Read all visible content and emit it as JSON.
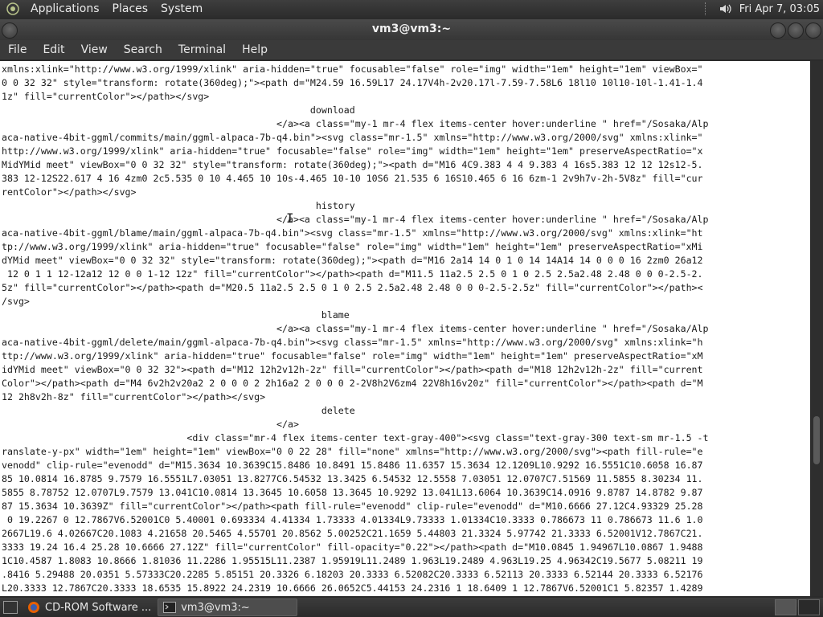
{
  "top_panel": {
    "menus": [
      "Applications",
      "Places",
      "System"
    ],
    "clock": "Fri Apr  7, 03:05"
  },
  "window": {
    "title": "vm3@vm3:~"
  },
  "menubar": {
    "items": [
      "File",
      "Edit",
      "View",
      "Search",
      "Terminal",
      "Help"
    ]
  },
  "terminal": {
    "content": "xmlns:xlink=\"http://www.w3.org/1999/xlink\" aria-hidden=\"true\" focusable=\"false\" role=\"img\" width=\"1em\" height=\"1em\" viewBox=\"\n0 0 32 32\" style=\"transform: rotate(360deg);\"><path d=\"M24.59 16.59L17 24.17V4h-2v20.17l-7.59-7.58L6 18l10 10l10-10l-1.41-1.4\n1z\" fill=\"currentColor\"></path></svg>\n                                                       download\n                                                 </a><a class=\"my-1 mr-4 flex items-center hover:underline \" href=\"/Sosaka/Alp\naca-native-4bit-ggml/commits/main/ggml-alpaca-7b-q4.bin\"><svg class=\"mr-1.5\" xmlns=\"http://www.w3.org/2000/svg\" xmlns:xlink=\"\nhttp://www.w3.org/1999/xlink\" aria-hidden=\"true\" focusable=\"false\" role=\"img\" width=\"1em\" height=\"1em\" preserveAspectRatio=\"x\nMidYMid meet\" viewBox=\"0 0 32 32\" style=\"transform: rotate(360deg);\"><path d=\"M16 4C9.383 4 4 9.383 4 16s5.383 12 12 12s12-5.\n383 12-12S22.617 4 16 4zm0 2c5.535 0 10 4.465 10 10s-4.465 10-10 10S6 21.535 6 16S10.465 6 16 6zm-1 2v9h7v-2h-5V8z\" fill=\"cur\nrentColor\"></path></svg>\n                                                        history\n                                                 </a><a class=\"my-1 mr-4 flex items-center hover:underline \" href=\"/Sosaka/Alp\naca-native-4bit-ggml/blame/main/ggml-alpaca-7b-q4.bin\"><svg class=\"mr-1.5\" xmlns=\"http://www.w3.org/2000/svg\" xmlns:xlink=\"ht\ntp://www.w3.org/1999/xlink\" aria-hidden=\"true\" focusable=\"false\" role=\"img\" width=\"1em\" height=\"1em\" preserveAspectRatio=\"xMi\ndYMid meet\" viewBox=\"0 0 32 32\" style=\"transform: rotate(360deg);\"><path d=\"M16 2a14 14 0 1 0 14 14A14 14 0 0 0 16 2zm0 26a12\n 12 0 1 1 12-12a12 12 0 0 1-12 12z\" fill=\"currentColor\"></path><path d=\"M11.5 11a2.5 2.5 0 1 0 2.5 2.5a2.48 2.48 0 0 0-2.5-2.\n5z\" fill=\"currentColor\"></path><path d=\"M20.5 11a2.5 2.5 0 1 0 2.5 2.5a2.48 2.48 0 0 0-2.5-2.5z\" fill=\"currentColor\"></path><\n/svg>\n                                                         blame\n                                                 </a><a class=\"my-1 mr-4 flex items-center hover:underline \" href=\"/Sosaka/Alp\naca-native-4bit-ggml/delete/main/ggml-alpaca-7b-q4.bin\"><svg class=\"mr-1.5\" xmlns=\"http://www.w3.org/2000/svg\" xmlns:xlink=\"h\nttp://www.w3.org/1999/xlink\" aria-hidden=\"true\" focusable=\"false\" role=\"img\" width=\"1em\" height=\"1em\" preserveAspectRatio=\"xM\nidYMid meet\" viewBox=\"0 0 32 32\"><path d=\"M12 12h2v12h-2z\" fill=\"currentColor\"></path><path d=\"M18 12h2v12h-2z\" fill=\"current\nColor\"></path><path d=\"M4 6v2h2v20a2 2 0 0 0 2 2h16a2 2 0 0 0 2-2V8h2V6zm4 22V8h16v20z\" fill=\"currentColor\"></path><path d=\"M\n12 2h8v2h-8z\" fill=\"currentColor\"></path></svg>\n                                                         delete\n                                                 </a>\n                                 <div class=\"mr-4 flex items-center text-gray-400\"><svg class=\"text-gray-300 text-sm mr-1.5 -t\nranslate-y-px\" width=\"1em\" height=\"1em\" viewBox=\"0 0 22 28\" fill=\"none\" xmlns=\"http://www.w3.org/2000/svg\"><path fill-rule=\"e\nvenodd\" clip-rule=\"evenodd\" d=\"M15.3634 10.3639C15.8486 10.8491 15.8486 11.6357 15.3634 12.1209L10.9292 16.5551C10.6058 16.87\n85 10.0814 16.8785 9.7579 16.5551L7.03051 13.8277C6.54532 13.3425 6.54532 12.5558 7.03051 12.0707C7.51569 11.5855 8.30234 11.\n5855 8.78752 12.0707L9.7579 13.041C10.0814 13.3645 10.6058 13.3645 10.9292 13.041L13.6064 10.3639C14.0916 9.8787 14.8782 9.87\n87 15.3634 10.3639Z\" fill=\"currentColor\"></path><path fill-rule=\"evenodd\" clip-rule=\"evenodd\" d=\"M10.6666 27.12C4.93329 25.28\n 0 19.2267 0 12.7867V6.52001C0 5.40001 0.693334 4.41334 1.73333 4.01334L9.73333 1.01334C10.3333 0.786673 11 0.786673 11.6 1.0\n2667L19.6 4.02667C20.1083 4.21658 20.5465 4.55701 20.8562 5.00252C21.1659 5.44803 21.3324 5.97742 21.3333 6.52001V12.7867C21.\n3333 19.24 16.4 25.28 10.6666 27.12Z\" fill=\"currentColor\" fill-opacity=\"0.22\"></path><path d=\"M10.0845 1.94967L10.0867 1.9488\n1C10.4587 1.8083 10.8666 1.81036 11.2286 1.95515L11.2387 1.95919L11.2489 1.963L19.2489 4.963L19.25 4.96342C19.5677 5.08211 19\n.8416 5.29488 20.0351 5.57333C20.2285 5.85151 20.3326 6.18203 20.3333 6.52082C20.3333 6.52113 20.3333 6.52144 20.3333 6.52176\nL20.3333 12.7867C20.3333 18.6535 15.8922 24.2319 10.6666 26.0652C5.44153 24.2316 1 18.6409 1 12.7867V6.52001C1 5.82357 1.4289"
  },
  "taskbar": {
    "tasks": [
      "CD-ROM Software ...",
      "vm3@vm3:~"
    ]
  },
  "colors": {
    "panel_bg": "#2c2c2c",
    "terminal_bg": "#ffffff",
    "terminal_fg": "#1a1a1a"
  }
}
